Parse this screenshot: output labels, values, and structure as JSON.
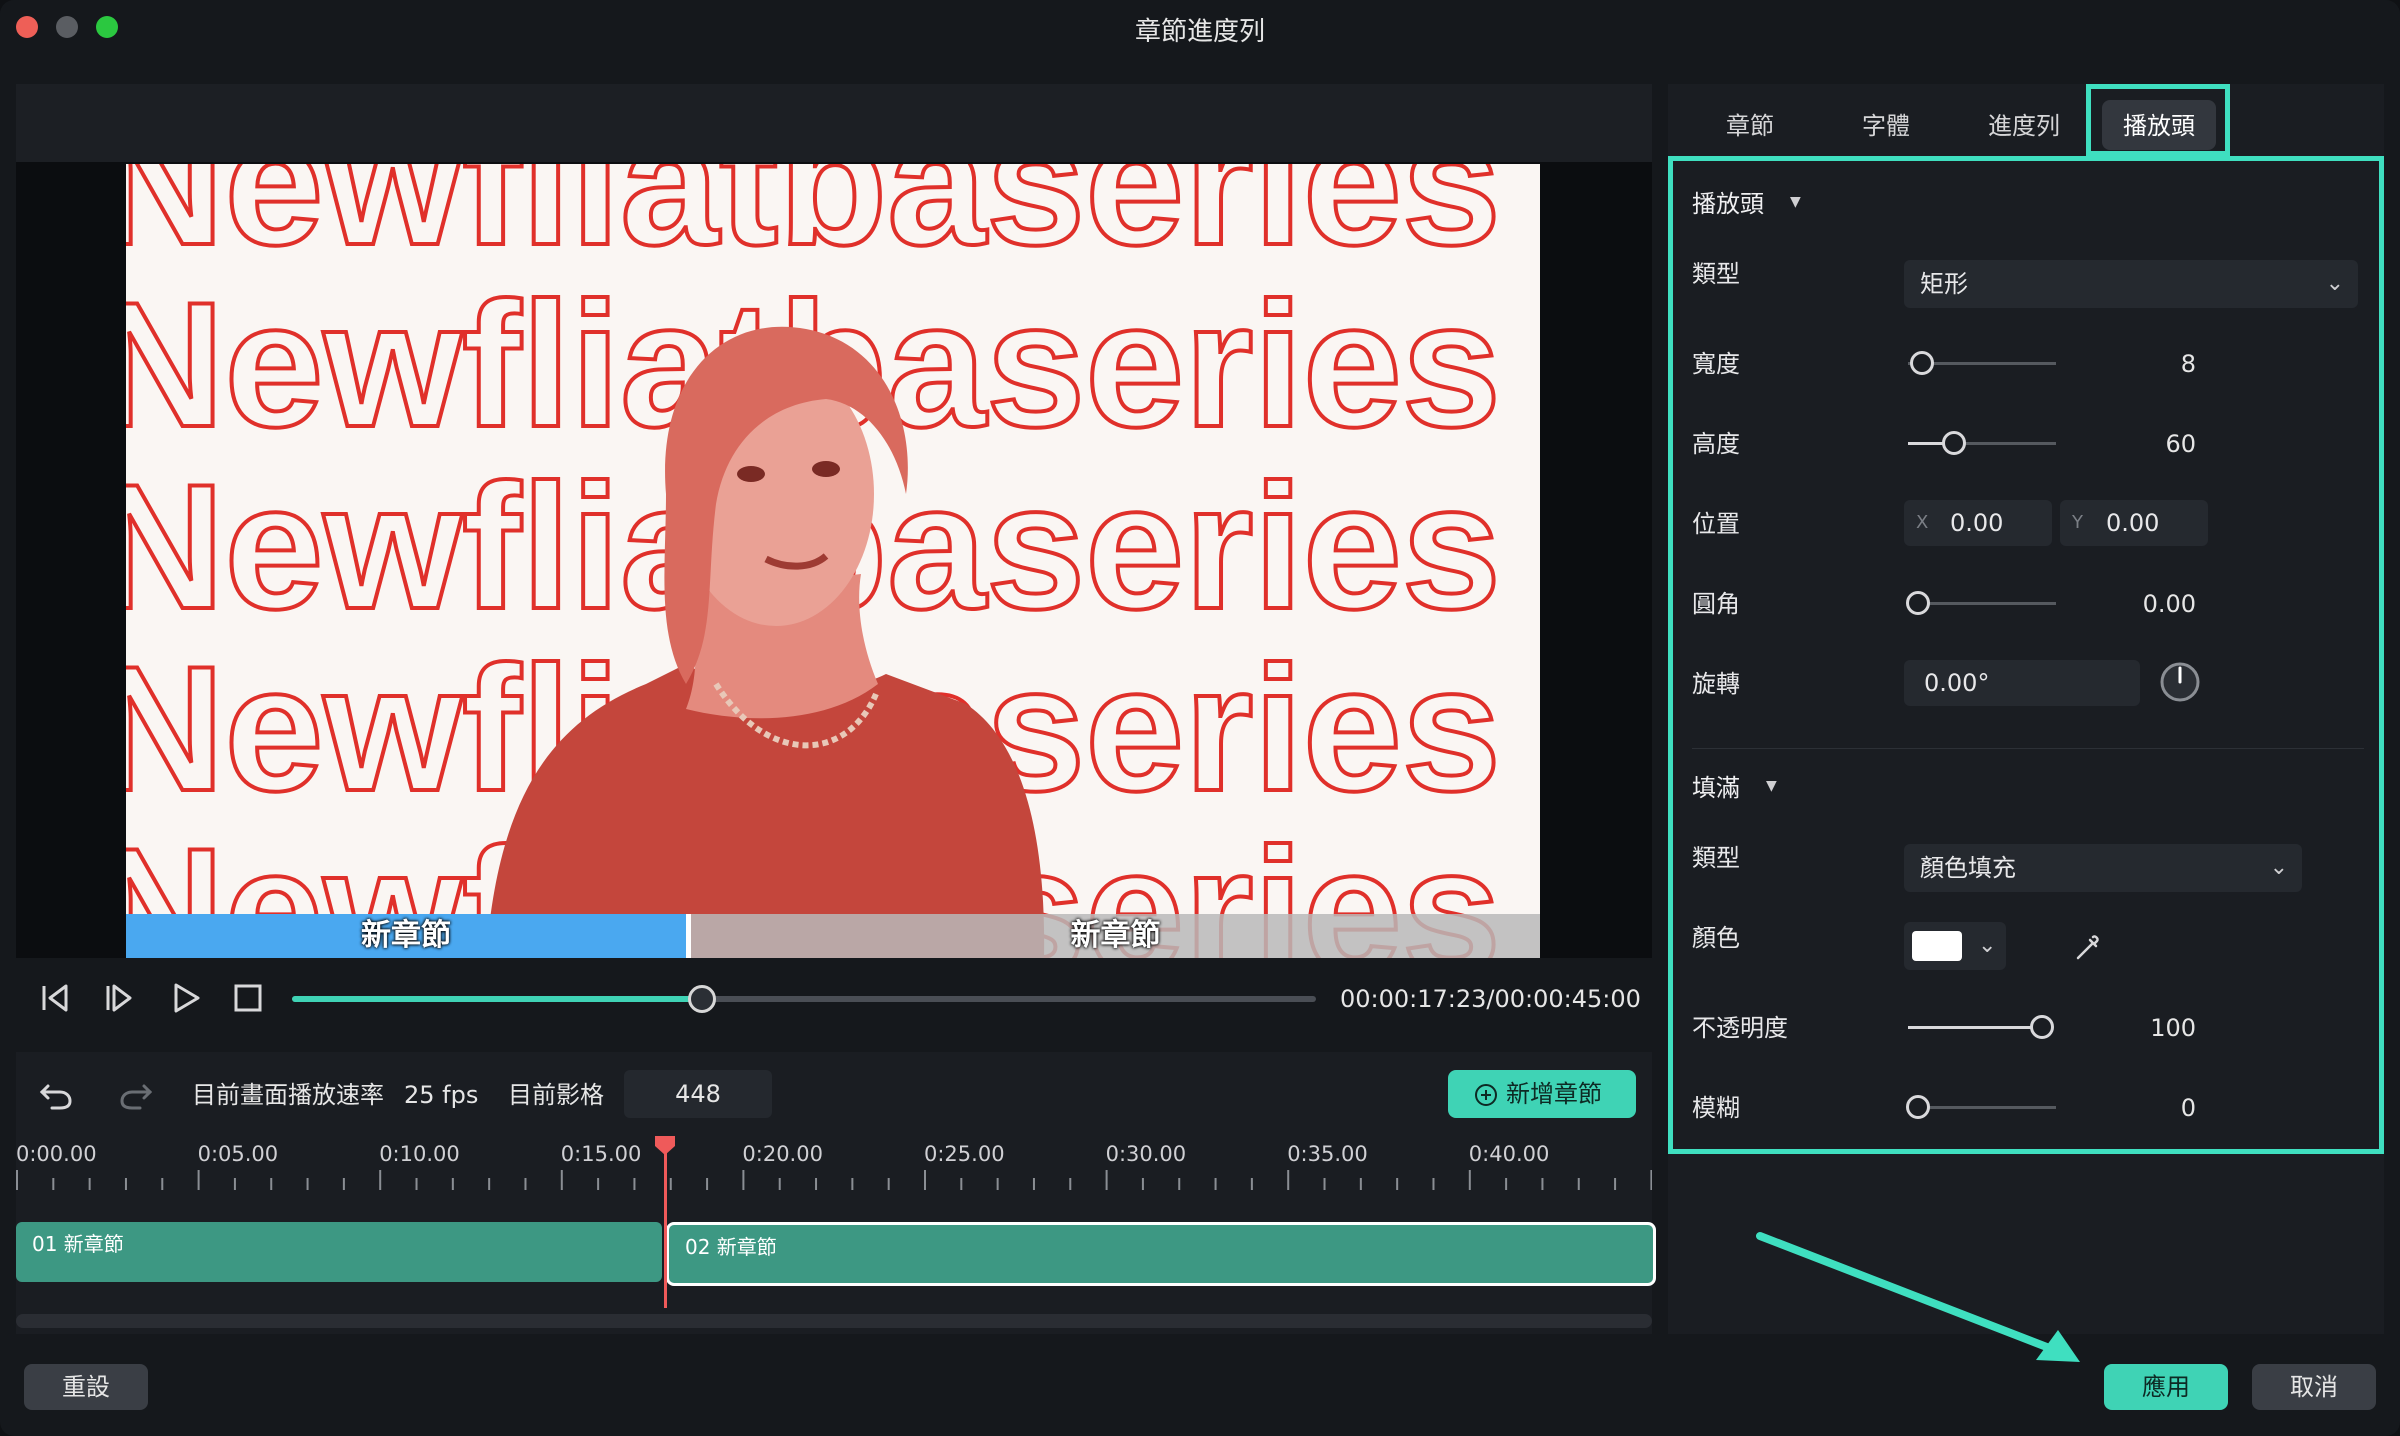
{
  "window": {
    "title": "章節進度列"
  },
  "preview": {
    "background_text": "Newfliatbaseries",
    "chapters": [
      {
        "label": "新章節",
        "color": "#4aa8f0"
      },
      {
        "label": "新章節",
        "color": "#b9b9b9"
      }
    ],
    "progress": 0.39
  },
  "player": {
    "timecode": "00:00:17:23/00:00:45:00",
    "buttons": [
      "prev-frame",
      "next-frame",
      "play",
      "stop"
    ]
  },
  "timeline": {
    "fps_label": "目前畫面播放速率",
    "fps_value": "25 fps",
    "frame_label": "目前影格",
    "frame_value": "448",
    "add_chapter_label": "新增章節",
    "ruler_ticks": [
      "0:00.00",
      "0:05.00",
      "0:10.00",
      "0:15.00",
      "0:20.00",
      "0:25.00",
      "0:30.00",
      "0:35.00",
      "0:40.00"
    ],
    "clips": [
      {
        "label": "01 新章節"
      },
      {
        "label": "02 新章節"
      }
    ]
  },
  "tabs": [
    "章節",
    "字體",
    "進度列",
    "播放頭"
  ],
  "active_tab": "播放頭",
  "playhead_section": {
    "title": "播放頭",
    "type_label": "類型",
    "type_value": "矩形",
    "width_label": "寬度",
    "width_value": "8",
    "height_label": "高度",
    "height_value": "60",
    "position_label": "位置",
    "pos_x_axis": "X",
    "pos_x": "0.00",
    "pos_y_axis": "Y",
    "pos_y": "0.00",
    "corner_label": "圓角",
    "corner_value": "0.00",
    "rotate_label": "旋轉",
    "rotate_value": "0.00°"
  },
  "fill_section": {
    "title": "填滿",
    "type_label": "類型",
    "type_value": "顏色填充",
    "color_label": "顏色",
    "color_value": "#ffffff",
    "opacity_label": "不透明度",
    "opacity_value": "100",
    "blur_label": "模糊",
    "blur_value": "0"
  },
  "footer": {
    "reset_label": "重設",
    "apply_label": "應用",
    "cancel_label": "取消"
  },
  "colors": {
    "accent": "#3fd3b5",
    "highlight": "#3fdfc0",
    "playhead": "#ef5a5a",
    "clip": "#3d9883"
  }
}
